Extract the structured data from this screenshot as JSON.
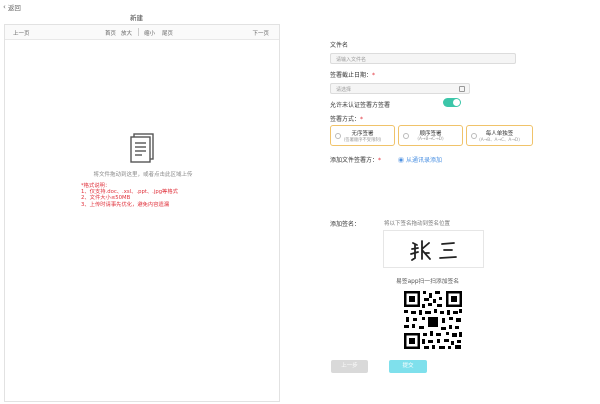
{
  "header": {
    "back_label": "返回",
    "doc_title": "新建"
  },
  "toolbar": {
    "prev_page": "上一页",
    "first_page": "首页",
    "zoom_in": "放大",
    "zoom_out": "缩小",
    "last_page": "尾页",
    "next_page": "下一页"
  },
  "preview": {
    "upload_text": "将文件拖动到这里，或者点击此区域上传",
    "format_lines": [
      "*格式说明：",
      "1、仅支持.doc、.xsl、.ppt、.jpg等格式",
      "2、文件大小≤50MB",
      "3、上传时请事先优化，避免内容遗漏"
    ]
  },
  "form": {
    "file_name_label": "文件名",
    "file_name_placeholder": "请输入文件名",
    "deadline_label": "签署截止日期：",
    "deadline_placeholder": "请选择",
    "allow_unverified_label": "允许未认证签署方签署",
    "allow_unverified_on": true,
    "method_label": "签署方式：",
    "methods": [
      {
        "title": "无序签署",
        "sub": "(签署顺序不受限制)"
      },
      {
        "title": "顺序签署",
        "sub": "(A→B→C→D)"
      },
      {
        "title": "每人单独签",
        "sub": "(A→B、A→C、A→D)"
      }
    ],
    "add_signer_label": "添加文件签署方：",
    "from_contacts": "从通讯录添加",
    "add_signature_label": "添加签名：",
    "drag_hint": "将以下签名拖动到签名位置",
    "signature_text": "张三",
    "app_hint": "易签app扫一扫添加签名",
    "prev_button": "上一步",
    "submit_button": "提交"
  },
  "colors": {
    "accent": "#3cc6a9",
    "required": "#e0303a",
    "method_border": "#f0c36a",
    "link": "#4a90e2",
    "submit": "#7fe0ec",
    "prev_button": "#d9d9d9"
  }
}
